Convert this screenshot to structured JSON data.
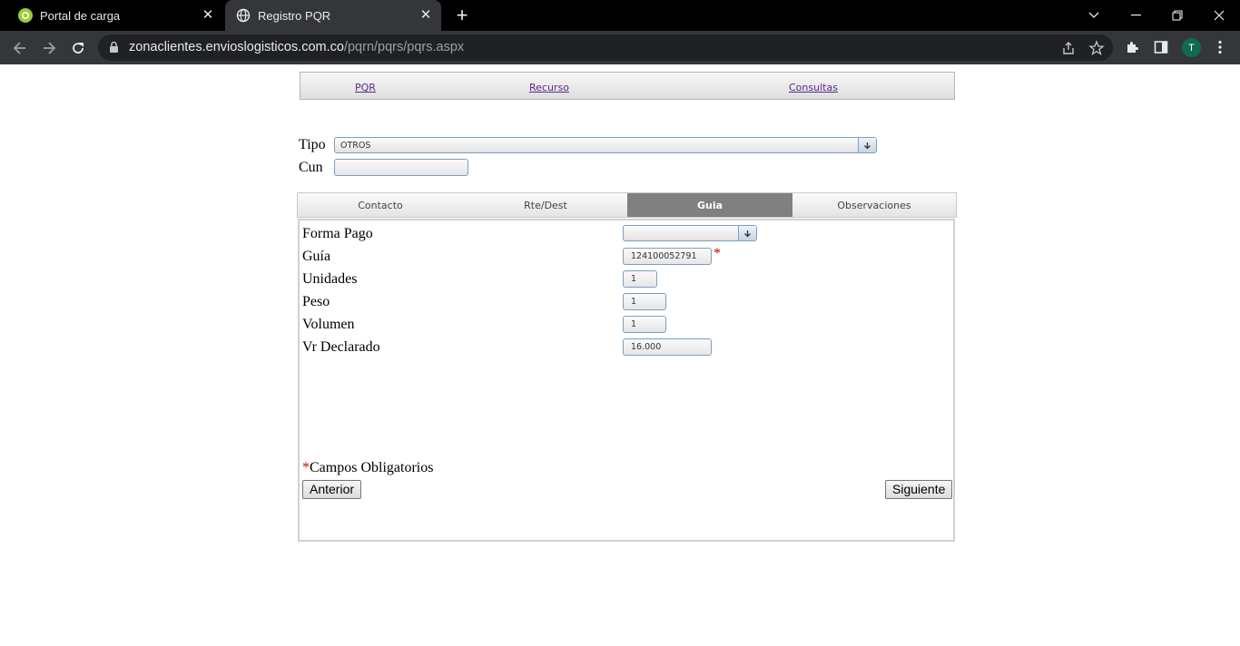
{
  "browser": {
    "tabs": [
      {
        "title": "Portal de carga",
        "active": false
      },
      {
        "title": "Registro PQR",
        "active": true
      }
    ],
    "url_host": "zonaclientes.envioslogisticos.com.co",
    "url_path": "/pqrn/pqrs/pqrs.aspx",
    "profile_initial": "T"
  },
  "menu": {
    "items": [
      "PQR",
      "Recurso",
      "Consultas"
    ]
  },
  "form": {
    "tipo_label": "Tipo",
    "tipo_value": "OTROS",
    "cun_label": "Cun",
    "cun_value": ""
  },
  "tabs": [
    "Contacto",
    "Rte/Dest",
    "Guia",
    "Observaciones"
  ],
  "active_tab": "Guia",
  "guia": {
    "forma_pago_label": "Forma Pago",
    "forma_pago_value": "",
    "guia_label": "Guía",
    "guia_value": "124100052791",
    "unidades_label": "Unidades",
    "unidades_value": "1",
    "peso_label": "Peso",
    "peso_value": "1",
    "volumen_label": "Volumen",
    "volumen_value": "1",
    "vr_declarado_label": "Vr Declarado",
    "vr_declarado_value": "16.000",
    "required_marker": "*"
  },
  "footer": {
    "required_note": "Campos Obligatorios",
    "prev_button": "Anterior",
    "next_button": "Siguiente"
  }
}
